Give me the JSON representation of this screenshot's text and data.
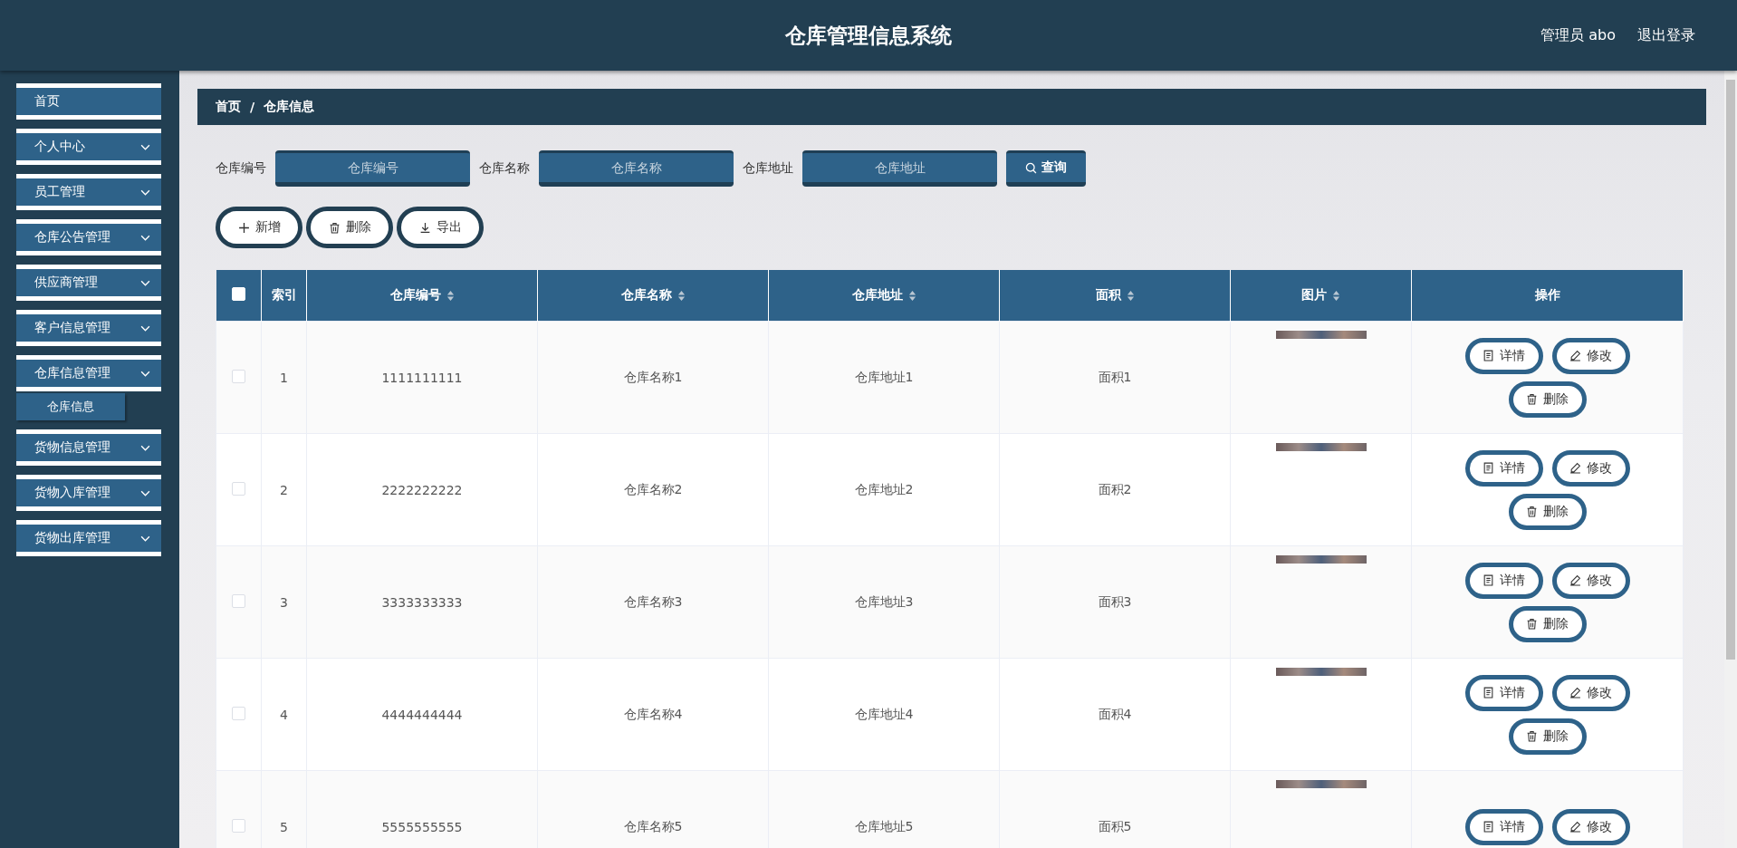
{
  "header": {
    "title": "仓库管理信息系统",
    "user": "管理员 abo",
    "logout": "退出登录"
  },
  "sidebar": {
    "items": [
      {
        "label": "首页",
        "kind": "link"
      },
      {
        "label": "个人中心",
        "kind": "menu"
      },
      {
        "label": "员工管理",
        "kind": "menu"
      },
      {
        "label": "仓库公告管理",
        "kind": "menu"
      },
      {
        "label": "供应商管理",
        "kind": "menu"
      },
      {
        "label": "客户信息管理",
        "kind": "menu"
      },
      {
        "label": "仓库信息管理",
        "kind": "menu",
        "children": [
          {
            "label": "仓库信息"
          }
        ]
      },
      {
        "label": "货物信息管理",
        "kind": "menu"
      },
      {
        "label": "货物入库管理",
        "kind": "menu"
      },
      {
        "label": "货物出库管理",
        "kind": "menu"
      }
    ]
  },
  "breadcrumb": [
    "首页",
    "仓库信息"
  ],
  "breadcrumb_separator": "/",
  "search": {
    "fields": [
      {
        "label": "仓库编号",
        "placeholder": "仓库编号"
      },
      {
        "label": "仓库名称",
        "placeholder": "仓库名称"
      },
      {
        "label": "仓库地址",
        "placeholder": "仓库地址"
      }
    ],
    "button": "查询"
  },
  "actions": [
    {
      "kind": "add",
      "label": "新增"
    },
    {
      "kind": "delete",
      "label": "删除"
    },
    {
      "kind": "export",
      "label": "导出"
    }
  ],
  "table": {
    "select_all_checked": false,
    "columns": [
      {
        "label": "索引",
        "sortable": false
      },
      {
        "label": "仓库编号",
        "sortable": true
      },
      {
        "label": "仓库名称",
        "sortable": true
      },
      {
        "label": "仓库地址",
        "sortable": true
      },
      {
        "label": "面积",
        "sortable": true
      },
      {
        "label": "图片",
        "sortable": true
      },
      {
        "label": "操作",
        "sortable": false
      }
    ],
    "rows": [
      {
        "checked": false,
        "cells": [
          "1",
          "1111111111",
          "仓库名称1",
          "仓库地址1",
          "面积1"
        ],
        "ops": [
          {
            "kind": "detail",
            "label": "详情"
          },
          {
            "kind": "edit",
            "label": "修改"
          },
          {
            "kind": "delete",
            "label": "删除"
          }
        ]
      },
      {
        "checked": false,
        "cells": [
          "2",
          "2222222222",
          "仓库名称2",
          "仓库地址2",
          "面积2"
        ],
        "ops": [
          {
            "kind": "detail",
            "label": "详情"
          },
          {
            "kind": "edit",
            "label": "修改"
          },
          {
            "kind": "delete",
            "label": "删除"
          }
        ]
      },
      {
        "checked": false,
        "cells": [
          "3",
          "3333333333",
          "仓库名称3",
          "仓库地址3",
          "面积3"
        ],
        "ops": [
          {
            "kind": "detail",
            "label": "详情"
          },
          {
            "kind": "edit",
            "label": "修改"
          },
          {
            "kind": "delete",
            "label": "删除"
          }
        ]
      },
      {
        "checked": false,
        "cells": [
          "4",
          "4444444444",
          "仓库名称4",
          "仓库地址4",
          "面积4"
        ],
        "ops": [
          {
            "kind": "detail",
            "label": "详情"
          },
          {
            "kind": "edit",
            "label": "修改"
          },
          {
            "kind": "delete",
            "label": "删除"
          }
        ]
      },
      {
        "checked": false,
        "cells": [
          "5",
          "5555555555",
          "仓库名称5",
          "仓库地址5",
          "面积5"
        ],
        "ops": [
          {
            "kind": "detail",
            "label": "详情"
          },
          {
            "kind": "edit",
            "label": "修改"
          }
        ]
      }
    ]
  }
}
